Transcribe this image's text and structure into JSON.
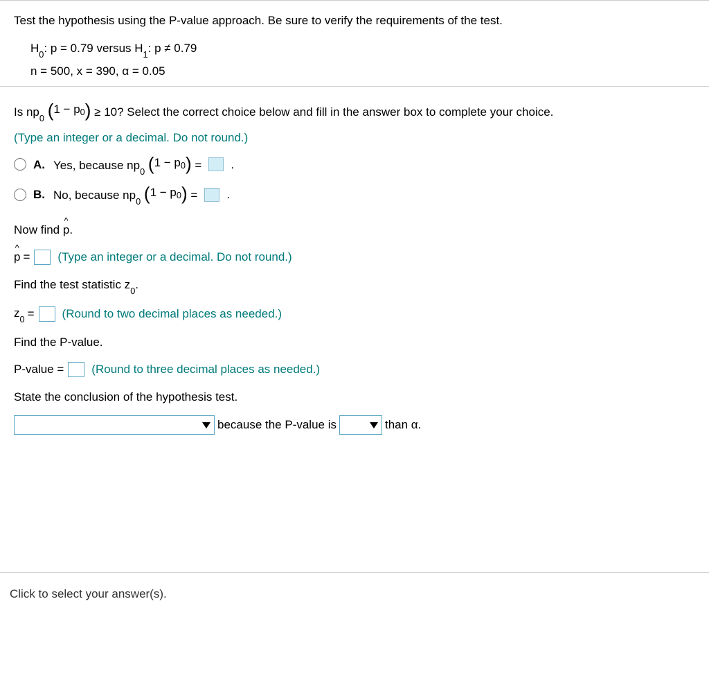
{
  "section1": {
    "intro": "Test the hypothesis using the P-value approach. Be sure to verify the requirements of the test.",
    "hypothesis_line1_prefix": "H",
    "hypothesis_line1_sub0": "0",
    "hypothesis_line1_mid": ": p = 0.79 versus H",
    "hypothesis_line1_sub1": "1",
    "hypothesis_line1_end": ": p ≠ 0.79",
    "hypothesis_line2": "n = 500, x = 390, α = 0.05"
  },
  "section2": {
    "q_prefix": "Is np",
    "q_sub": "0",
    "q_paren_inner_a": "1 − p",
    "q_paren_inner_sub": "0",
    "q_after": " ≥ 10? Select the correct choice below and fill in the answer box to complete your choice.",
    "hint": "(Type an integer or a decimal. Do not round.)",
    "optA_label": "A.",
    "optA_text_a": "Yes, because np",
    "optA_text_sub": "0",
    "optA_paren_a": "1 − p",
    "optA_paren_sub": "0",
    "optA_eq": " = ",
    "optA_period": ".",
    "optB_label": "B.",
    "optB_text_a": "No, because np",
    "optB_text_sub": "0",
    "optB_paren_a": "1 − p",
    "optB_paren_sub": "0",
    "optB_eq": " = ",
    "optB_period": ".",
    "find_p_hat": "Now find p.",
    "p_hat_prefix": "p",
    "p_hat_eq": " = ",
    "p_hat_hint": "(Type an integer or a decimal. Do not round.)",
    "find_z0_text_a": "Find the test statistic z",
    "find_z0_sub": "0",
    "find_z0_period": ".",
    "z0_prefix": "z",
    "z0_sub": "0",
    "z0_eq": " = ",
    "z0_hint": "(Round to two decimal places as needed.)",
    "find_pvalue": "Find the P-value.",
    "pvalue_prefix": "P-value = ",
    "pvalue_hint": "(Round to three decimal places as needed.)",
    "conclusion_intro": "State the conclusion of the hypothesis test.",
    "conclusion_mid": " because the P-value is ",
    "conclusion_end": " than α."
  },
  "footer": {
    "text": "Click to select your answer(s)."
  }
}
